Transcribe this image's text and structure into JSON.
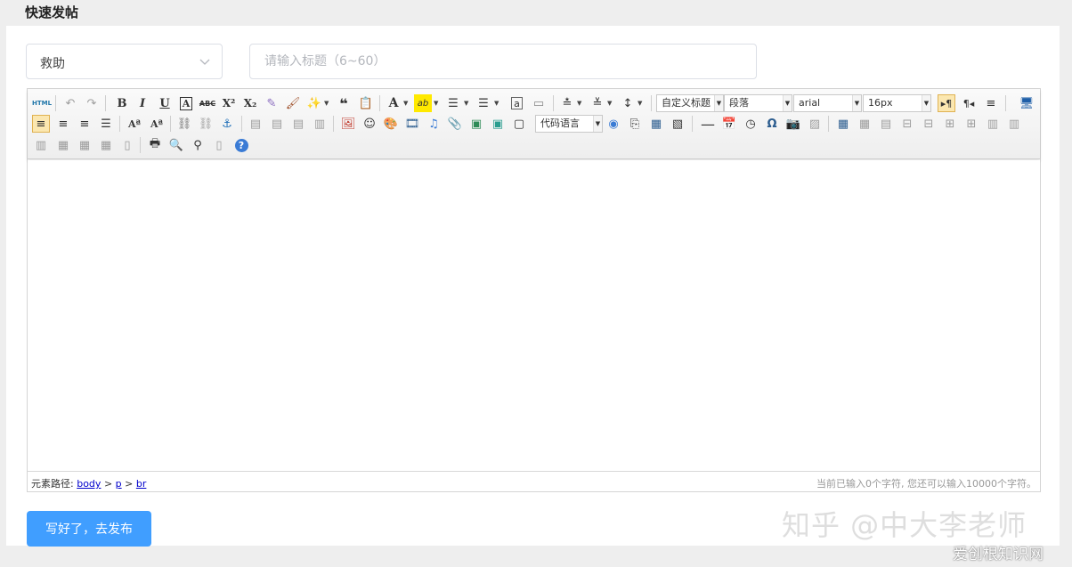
{
  "header": {
    "title": "快速发帖"
  },
  "form": {
    "category": "救助",
    "title_placeholder": "请输入标题（6~60）"
  },
  "toolbar": {
    "source_label": "HTML",
    "bold": "B",
    "italic": "I",
    "underline": "U",
    "fontborder": "A",
    "strike": "ABC",
    "superscript": "X²",
    "subscript": "X₂",
    "blockquote": "❝",
    "forecolor": "A",
    "backcolor": "ab",
    "custom_style": "自定义标题",
    "paragraph": "段落",
    "font_family": "arial",
    "font_size": "16px",
    "code_language": "代码语言",
    "omega": "Ω"
  },
  "statusbar": {
    "path_label": "元素路径:",
    "path": [
      "body",
      "p",
      "br"
    ],
    "separator": ">",
    "count_text": "当前已输入0个字符, 您还可以输入10000个字符。"
  },
  "publish": {
    "label": "写好了，去发布"
  },
  "watermark": {
    "main": "知乎 @中大李老师",
    "sub": "爱创根知识网"
  }
}
